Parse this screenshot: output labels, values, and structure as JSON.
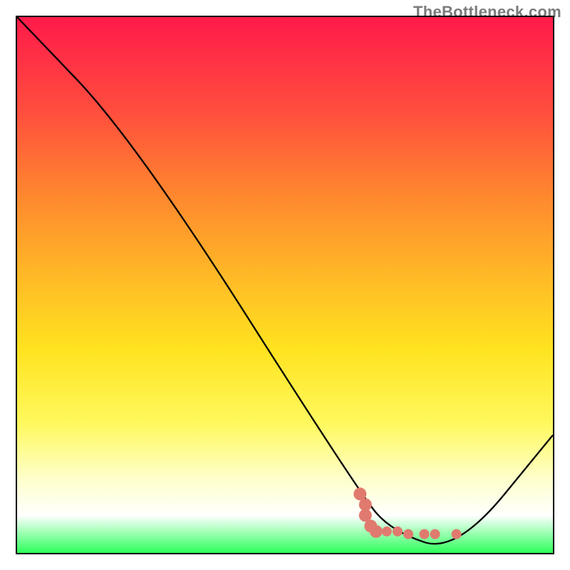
{
  "watermark": "TheBottleneck.com",
  "chart_data": {
    "type": "line",
    "title": "",
    "xlabel": "",
    "ylabel": "",
    "xlim": [
      0,
      100
    ],
    "ylim": [
      0,
      100
    ],
    "series": [
      {
        "name": "bottleneck-curve",
        "x": [
          0,
          22,
          64,
          70,
          82,
          100
        ],
        "y": [
          100,
          77,
          11,
          4,
          0,
          22
        ],
        "color": "#000000"
      }
    ],
    "highlight_cluster": {
      "name": "ideal-range-points",
      "color": "#e07a6f",
      "points": [
        {
          "x": 64,
          "y": 11
        },
        {
          "x": 65,
          "y": 9
        },
        {
          "x": 65,
          "y": 7
        },
        {
          "x": 66,
          "y": 5
        },
        {
          "x": 67,
          "y": 4
        },
        {
          "x": 69,
          "y": 4
        },
        {
          "x": 71,
          "y": 4
        },
        {
          "x": 73,
          "y": 3.5
        },
        {
          "x": 76,
          "y": 3.5
        },
        {
          "x": 78,
          "y": 3.5
        },
        {
          "x": 82,
          "y": 3.5
        }
      ]
    },
    "gradient_stops": [
      {
        "pos": 0,
        "color": "#ff1a4b"
      },
      {
        "pos": 18,
        "color": "#ff4f3d"
      },
      {
        "pos": 34,
        "color": "#ff8a2e"
      },
      {
        "pos": 48,
        "color": "#ffb827"
      },
      {
        "pos": 62,
        "color": "#ffe31f"
      },
      {
        "pos": 76,
        "color": "#fff95f"
      },
      {
        "pos": 86,
        "color": "#feffc9"
      },
      {
        "pos": 93,
        "color": "#ffffff"
      },
      {
        "pos": 100,
        "color": "#2cff5a"
      }
    ]
  }
}
